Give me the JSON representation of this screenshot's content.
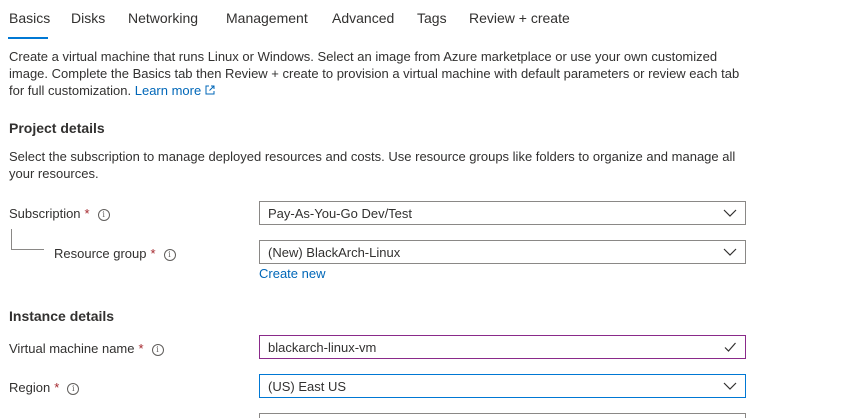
{
  "tabs": [
    {
      "label": "Basics",
      "active": true
    },
    {
      "label": "Disks"
    },
    {
      "label": "Networking"
    },
    {
      "label": "Management"
    },
    {
      "label": "Advanced"
    },
    {
      "label": "Tags"
    },
    {
      "label": "Review + create"
    }
  ],
  "intro": {
    "text": "Create a virtual machine that runs Linux or Windows. Select an image from Azure marketplace or use your own customized image. Complete the Basics tab then Review + create to provision a virtual machine with default parameters or review each tab for full customization.",
    "learn_more": "Learn more"
  },
  "project_details": {
    "title": "Project details",
    "description": "Select the subscription to manage deployed resources and costs. Use resource groups like folders to organize and manage all your resources.",
    "subscription": {
      "label": "Subscription",
      "value": "Pay-As-You-Go Dev/Test"
    },
    "resource_group": {
      "label": "Resource group",
      "value": "(New) BlackArch-Linux",
      "create_new": "Create new"
    }
  },
  "instance_details": {
    "title": "Instance details",
    "vm_name": {
      "label": "Virtual machine name",
      "value": "blackarch-linux-vm"
    },
    "region": {
      "label": "Region",
      "value": "(US) East US"
    }
  },
  "required_mark": "*",
  "info_glyph": "i",
  "colors": {
    "accent": "#0078d4",
    "link": "#0067b8",
    "required": "#a4262c",
    "valid": "#107c10"
  }
}
